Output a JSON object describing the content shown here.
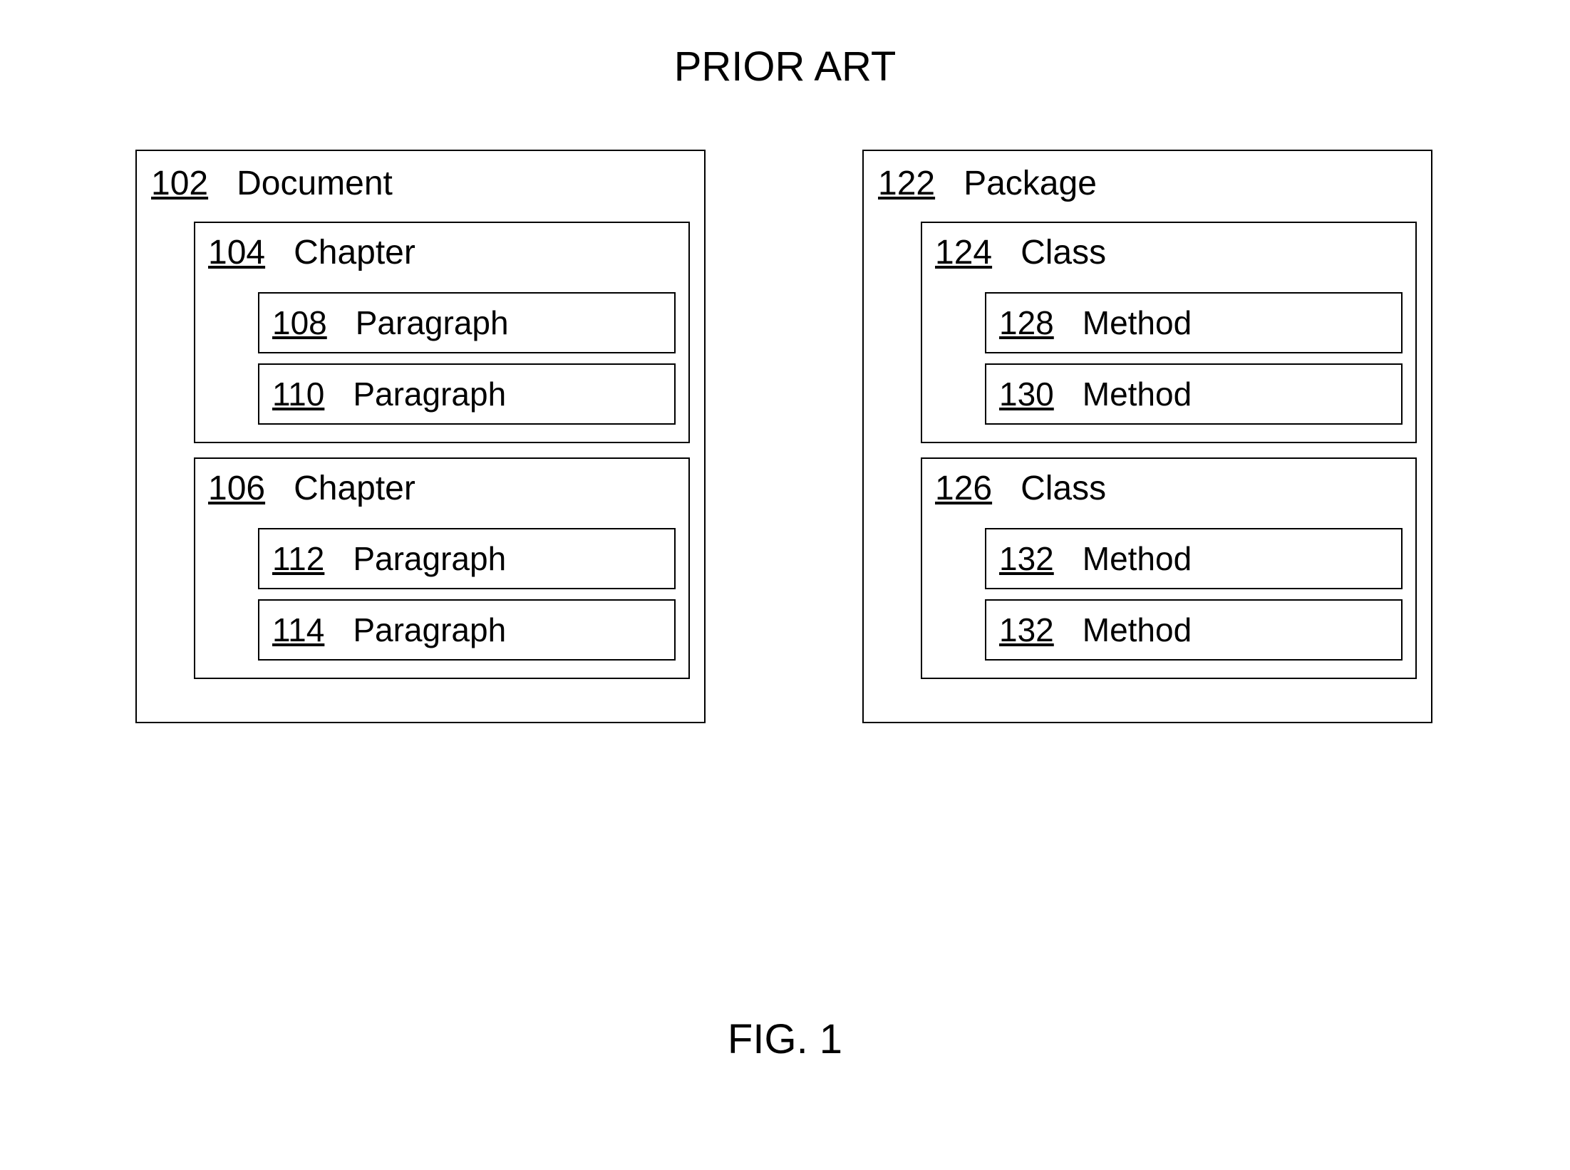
{
  "title": "PRIOR ART",
  "figure_label": "FIG. 1",
  "left": {
    "ref": "102",
    "label": "Document",
    "groups": [
      {
        "ref": "104",
        "label": "Chapter",
        "items": [
          {
            "ref": "108",
            "label": "Paragraph"
          },
          {
            "ref": "110",
            "label": "Paragraph"
          }
        ]
      },
      {
        "ref": "106",
        "label": "Chapter",
        "items": [
          {
            "ref": "112",
            "label": "Paragraph"
          },
          {
            "ref": "114",
            "label": "Paragraph"
          }
        ]
      }
    ]
  },
  "right": {
    "ref": "122",
    "label": "Package",
    "groups": [
      {
        "ref": "124",
        "label": "Class",
        "items": [
          {
            "ref": "128",
            "label": "Method"
          },
          {
            "ref": "130",
            "label": "Method"
          }
        ]
      },
      {
        "ref": "126",
        "label": "Class",
        "items": [
          {
            "ref": "132",
            "label": "Method"
          },
          {
            "ref": "132",
            "label": "Method"
          }
        ]
      }
    ]
  }
}
